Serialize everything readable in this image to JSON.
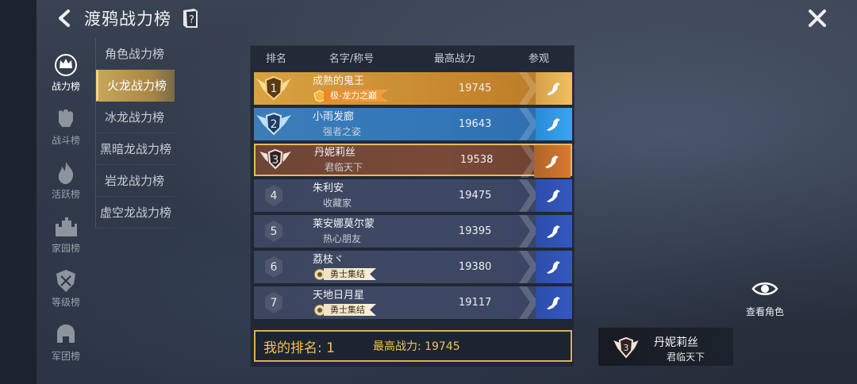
{
  "header": {
    "title": "渡鸦战力榜"
  },
  "nav": [
    {
      "label": "战力榜",
      "icon": "crown-shield-icon",
      "active": true
    },
    {
      "label": "战斗榜",
      "icon": "fist-icon",
      "active": false
    },
    {
      "label": "活跃榜",
      "icon": "flame-icon",
      "active": false
    },
    {
      "label": "家园榜",
      "icon": "castle-icon",
      "active": false
    },
    {
      "label": "等级榜",
      "icon": "shield-icon",
      "active": false
    },
    {
      "label": "军团榜",
      "icon": "helmet-icon",
      "active": false
    }
  ],
  "categories": [
    {
      "label": "角色战力榜",
      "active": false
    },
    {
      "label": "火龙战力榜",
      "active": true
    },
    {
      "label": "冰龙战力榜",
      "active": false
    },
    {
      "label": "黑暗龙战力榜",
      "active": false
    },
    {
      "label": "岩龙战力榜",
      "active": false
    },
    {
      "label": "虚空龙战力榜",
      "active": false
    }
  ],
  "table": {
    "headers": {
      "rank": "排名",
      "name": "名字/称号",
      "power": "最高战力",
      "view": "参观"
    },
    "rows": [
      {
        "rank": "1",
        "name": "成熟的鬼王",
        "title": "极-龙力之巅",
        "title_style": "tag",
        "power": "19745"
      },
      {
        "rank": "2",
        "name": "小雨发廊",
        "title": "强者之姿",
        "title_style": "text",
        "power": "19643"
      },
      {
        "rank": "3",
        "name": "丹妮莉丝",
        "title": "君临天下",
        "title_style": "text",
        "power": "19538"
      },
      {
        "rank": "4",
        "name": "朱利安",
        "title": "收藏家",
        "title_style": "text",
        "power": "19475"
      },
      {
        "rank": "5",
        "name": "莱安娜莫尔蒙",
        "title": "热心朋友",
        "title_style": "text",
        "power": "19395"
      },
      {
        "rank": "6",
        "name": "荔枝ヾ",
        "title": "勇士集结",
        "title_style": "tag",
        "power": "19380"
      },
      {
        "rank": "7",
        "name": "天地日月星",
        "title": "勇士集结",
        "title_style": "tag",
        "power": "19117"
      }
    ]
  },
  "my_rank": {
    "rank_text": "我的排名: 1",
    "power_text": "最高战力: 19745"
  },
  "view_role": {
    "label": "查看角色"
  },
  "selected": {
    "rank": "3",
    "name": "丹妮莉丝",
    "title": "君临天下"
  },
  "colors": {
    "gold": "#f2c450",
    "rank1": "#d9a242",
    "rank2": "#3c7db8",
    "rank3": "#7a4a38",
    "normal": "#3e4865"
  }
}
